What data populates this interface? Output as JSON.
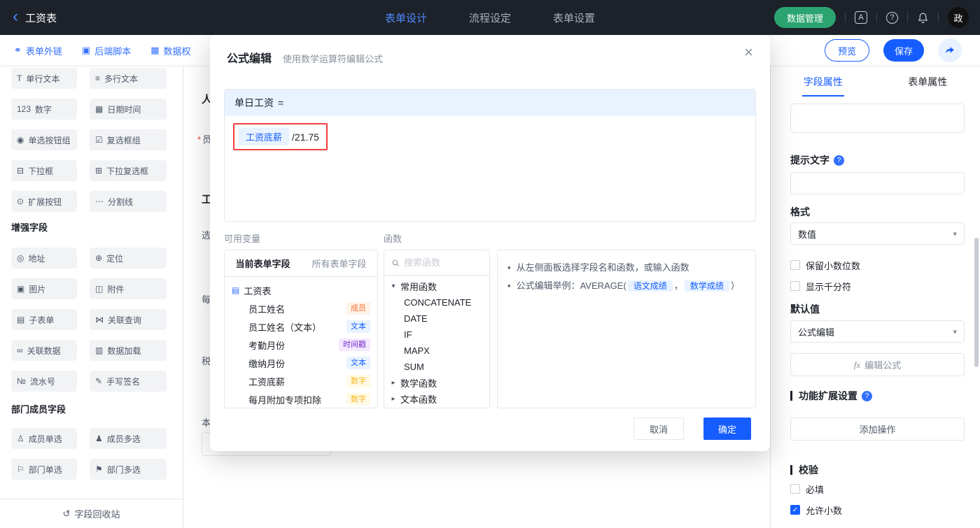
{
  "colors": {
    "accent_blue": "#165dff",
    "green_button": "#2ba471",
    "highlight_red": "#f53f3f",
    "topbar_bg": "#1d2129",
    "tag_member": "#f77234",
    "tag_text": "#165dff",
    "tag_timestamp": "#722ed1",
    "tag_number": "#f7ba1e"
  },
  "ui": {
    "bullet": "•",
    "check": "✓",
    "chevron_down": "▾",
    "chevron_right": "▸",
    "equals": "="
  },
  "topbar": {
    "back_icon": "‹",
    "title": "工资表",
    "tabs": [
      {
        "label": "表单设计"
      },
      {
        "label": "流程设定"
      },
      {
        "label": "表单设置"
      }
    ],
    "data_manage": "数据管理",
    "translate_icon": "A",
    "help_icon": "?",
    "avatar": "政"
  },
  "toolbar": {
    "links": [
      {
        "icon": "⚭",
        "label": "表单外链"
      },
      {
        "icon": "▣",
        "label": "后端脚本"
      },
      {
        "icon": "▦",
        "label": "数据权"
      }
    ],
    "preview": "预览",
    "save": "保存"
  },
  "sidebar": {
    "fields": [
      {
        "icon": "T",
        "label": "单行文本"
      },
      {
        "icon": "≡",
        "label": "多行文本"
      },
      {
        "icon": "123",
        "label": "数字"
      },
      {
        "icon": "▦",
        "label": "日期时间"
      },
      {
        "icon": "◉",
        "label": "单选按钮组"
      },
      {
        "icon": "☑",
        "label": "复选框组"
      },
      {
        "icon": "⊟",
        "label": "下拉框"
      },
      {
        "icon": "⊞",
        "label": "下拉复选框"
      },
      {
        "icon": "⊙",
        "label": "扩展按钮"
      },
      {
        "icon": "⋯",
        "label": "分割线"
      }
    ],
    "enhanced_title": "增强字段",
    "enhanced": [
      {
        "icon": "◎",
        "label": "地址"
      },
      {
        "icon": "⊕",
        "label": "定位"
      },
      {
        "icon": "▣",
        "label": "图片"
      },
      {
        "icon": "◫",
        "label": "附件"
      },
      {
        "icon": "▤",
        "label": "子表单"
      },
      {
        "icon": "⋈",
        "label": "关联查询"
      },
      {
        "icon": "∞",
        "label": "关联数据"
      },
      {
        "icon": "▥",
        "label": "数据加载"
      },
      {
        "icon": "№",
        "label": "流水号"
      },
      {
        "icon": "✎",
        "label": "手写签名"
      }
    ],
    "dept_title": "部门成员字段",
    "dept": [
      {
        "icon": "♙",
        "label": "成员单选"
      },
      {
        "icon": "♟",
        "label": "成员多选"
      },
      {
        "icon": "⚐",
        "label": "部门单选"
      },
      {
        "icon": "⚑",
        "label": "部门多选"
      }
    ],
    "recycle": {
      "icon": "↺",
      "label": "字段回收站"
    }
  },
  "canvas": {
    "f1": "人",
    "required_mark": "*",
    "f2": "员",
    "f3": "工",
    "f4": "选",
    "f5": "每",
    "f6": "税",
    "f7": "本"
  },
  "modal": {
    "title": "公式编辑",
    "subtitle": "使用数学运算符编辑公式",
    "close_icon": "×",
    "formula_target": "单日工资",
    "highlight": {
      "chip": "工资底薪",
      "rest": "/21.75"
    },
    "vars_label": "可用变量",
    "funcs_label": "函数",
    "vars": {
      "tabs": [
        {
          "label": "当前表单字段"
        },
        {
          "label": "所有表单字段"
        }
      ],
      "root_icon": "▤",
      "root": "工资表",
      "fields": [
        {
          "name": "员工姓名",
          "tag": "成员",
          "type": "member"
        },
        {
          "name": "员工姓名（文本）",
          "tag": "文本",
          "type": "text"
        },
        {
          "name": "考勤月份",
          "tag": "时间戳",
          "type": "timestamp"
        },
        {
          "name": "缴纳月份",
          "tag": "文本",
          "type": "text"
        },
        {
          "name": "工资底薪",
          "tag": "数字",
          "type": "number"
        },
        {
          "name": "每月附加专项扣除",
          "tag": "数字",
          "type": "number"
        }
      ]
    },
    "funcs": {
      "search_placeholder": "搜索函数",
      "groups": [
        {
          "name": "常用函数"
        },
        {
          "name": "数学函数"
        },
        {
          "name": "文本函数"
        }
      ],
      "common_items": [
        "CONCATENATE",
        "DATE",
        "IF",
        "MAPX",
        "SUM"
      ]
    },
    "help": {
      "line1": "从左侧面板选择字段名和函数，或输入函数",
      "line2_prefix": "公式编辑举例：AVERAGE(",
      "chip_a": "语文成绩",
      "separator": "，",
      "chip_b": "数学成绩",
      "line2_suffix": "）"
    },
    "cancel": "取消",
    "ok": "确定"
  },
  "panel": {
    "tabs": [
      {
        "label": "字段属性"
      },
      {
        "label": "表单属性"
      }
    ],
    "hint_label": "提示文字",
    "help_q": "?",
    "format_label": "格式",
    "format_value": "数值",
    "cb_decimal": "保留小数位数",
    "cb_thousand": "显示千分符",
    "default_label": "默认值",
    "default_value": "公式编辑",
    "fx": "fx",
    "edit_formula": "编辑公式",
    "ext_label": "功能扩展设置",
    "add_action": "添加操作",
    "validate_label": "校验",
    "cb_required": "必填",
    "cb_allow_decimal": "允许小数"
  }
}
